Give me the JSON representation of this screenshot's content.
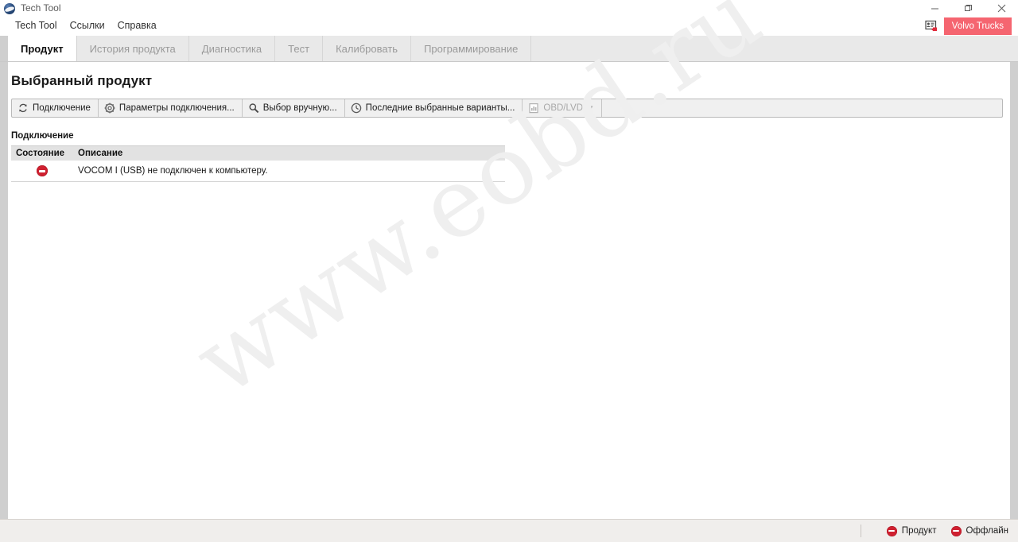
{
  "window": {
    "title": "Tech Tool",
    "app_icon": "globe-icon",
    "minimize_label": "minimize",
    "maximize_label": "restore",
    "close_label": "close"
  },
  "menubar": {
    "items": [
      {
        "label": "Tech Tool",
        "name": "menu-tech-tool"
      },
      {
        "label": "Ссылки",
        "name": "menu-links"
      },
      {
        "label": "Справка",
        "name": "menu-help"
      }
    ]
  },
  "brand": {
    "icon": "user-card-icon",
    "badge_label": "Volvo Trucks",
    "badge_color": "#F56570",
    "badge_text_color": "#ffffff"
  },
  "tabs": [
    {
      "label": "Продукт",
      "name": "tab-product",
      "active": true
    },
    {
      "label": "История продукта",
      "name": "tab-product-history",
      "active": false
    },
    {
      "label": "Диагностика",
      "name": "tab-diagnostics",
      "active": false
    },
    {
      "label": "Тест",
      "name": "tab-test",
      "active": false
    },
    {
      "label": "Калибровать",
      "name": "tab-calibrate",
      "active": false
    },
    {
      "label": "Программирование",
      "name": "tab-programming",
      "active": false
    }
  ],
  "page": {
    "title": "Выбранный продукт"
  },
  "toolbar": {
    "buttons": [
      {
        "label": "Подключение",
        "icon": "refresh-connect-icon",
        "name": "toolbar-connect-button",
        "disabled": false,
        "caret": false
      },
      {
        "label": "Параметры подключения...",
        "icon": "gear-icon",
        "name": "toolbar-connection-settings-button",
        "disabled": false,
        "caret": false
      },
      {
        "label": "Выбор вручную...",
        "icon": "search-icon",
        "name": "toolbar-manual-selection-button",
        "disabled": false,
        "caret": false
      },
      {
        "label": "Последние выбранные варианты...",
        "icon": "clock-icon",
        "name": "toolbar-recent-selections-button",
        "disabled": false,
        "caret": false
      },
      {
        "label": "OBD/LVD",
        "icon": "chart-document-icon",
        "name": "toolbar-obd-lvd-button",
        "disabled": true,
        "caret": true
      }
    ],
    "caret_glyph": "▼"
  },
  "connection_section": {
    "label": "Подключение",
    "table": {
      "columns": [
        "Состояние",
        "Описание"
      ],
      "rows": [
        {
          "status_icon": "error-circle-icon",
          "status_color": "#CF2030",
          "description": "VOCOM I (USB) не подключен к компьютеру."
        }
      ]
    }
  },
  "watermark": {
    "text": "www.eobd.ru"
  },
  "statusbar": {
    "items": [
      {
        "label": "Продукт",
        "icon": "error-circle-icon",
        "color": "#CF2030",
        "name": "statusbar-product"
      },
      {
        "label": "Оффлайн",
        "icon": "error-circle-icon",
        "color": "#CF2030",
        "name": "statusbar-offline"
      }
    ]
  }
}
